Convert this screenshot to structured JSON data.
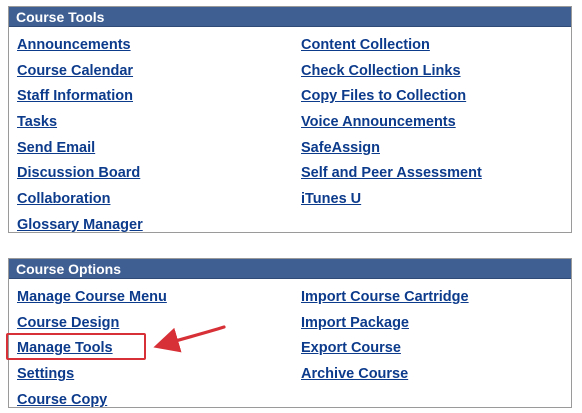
{
  "course_tools": {
    "title": "Course Tools",
    "left_links": [
      "Announcements",
      "Course Calendar",
      "Staff Information",
      "Tasks",
      "Send Email",
      "Discussion Board",
      "Collaboration",
      "Glossary Manager"
    ],
    "right_links": [
      "Content Collection",
      "Check Collection Links",
      "Copy Files to Collection",
      "Voice Announcements",
      "SafeAssign",
      "Self and Peer Assessment",
      "iTunes U"
    ]
  },
  "course_options": {
    "title": "Course Options",
    "left_links": [
      "Manage Course Menu",
      "Course Design",
      "Manage Tools",
      "Settings",
      "Course Copy"
    ],
    "right_links": [
      "Import Course Cartridge",
      "Import Package",
      "Export Course",
      "Archive Course"
    ]
  },
  "annotation": {
    "highlight_color": "#d73036"
  },
  "colors": {
    "header_bg": "#3f5f93",
    "link": "#0d3b8c"
  }
}
